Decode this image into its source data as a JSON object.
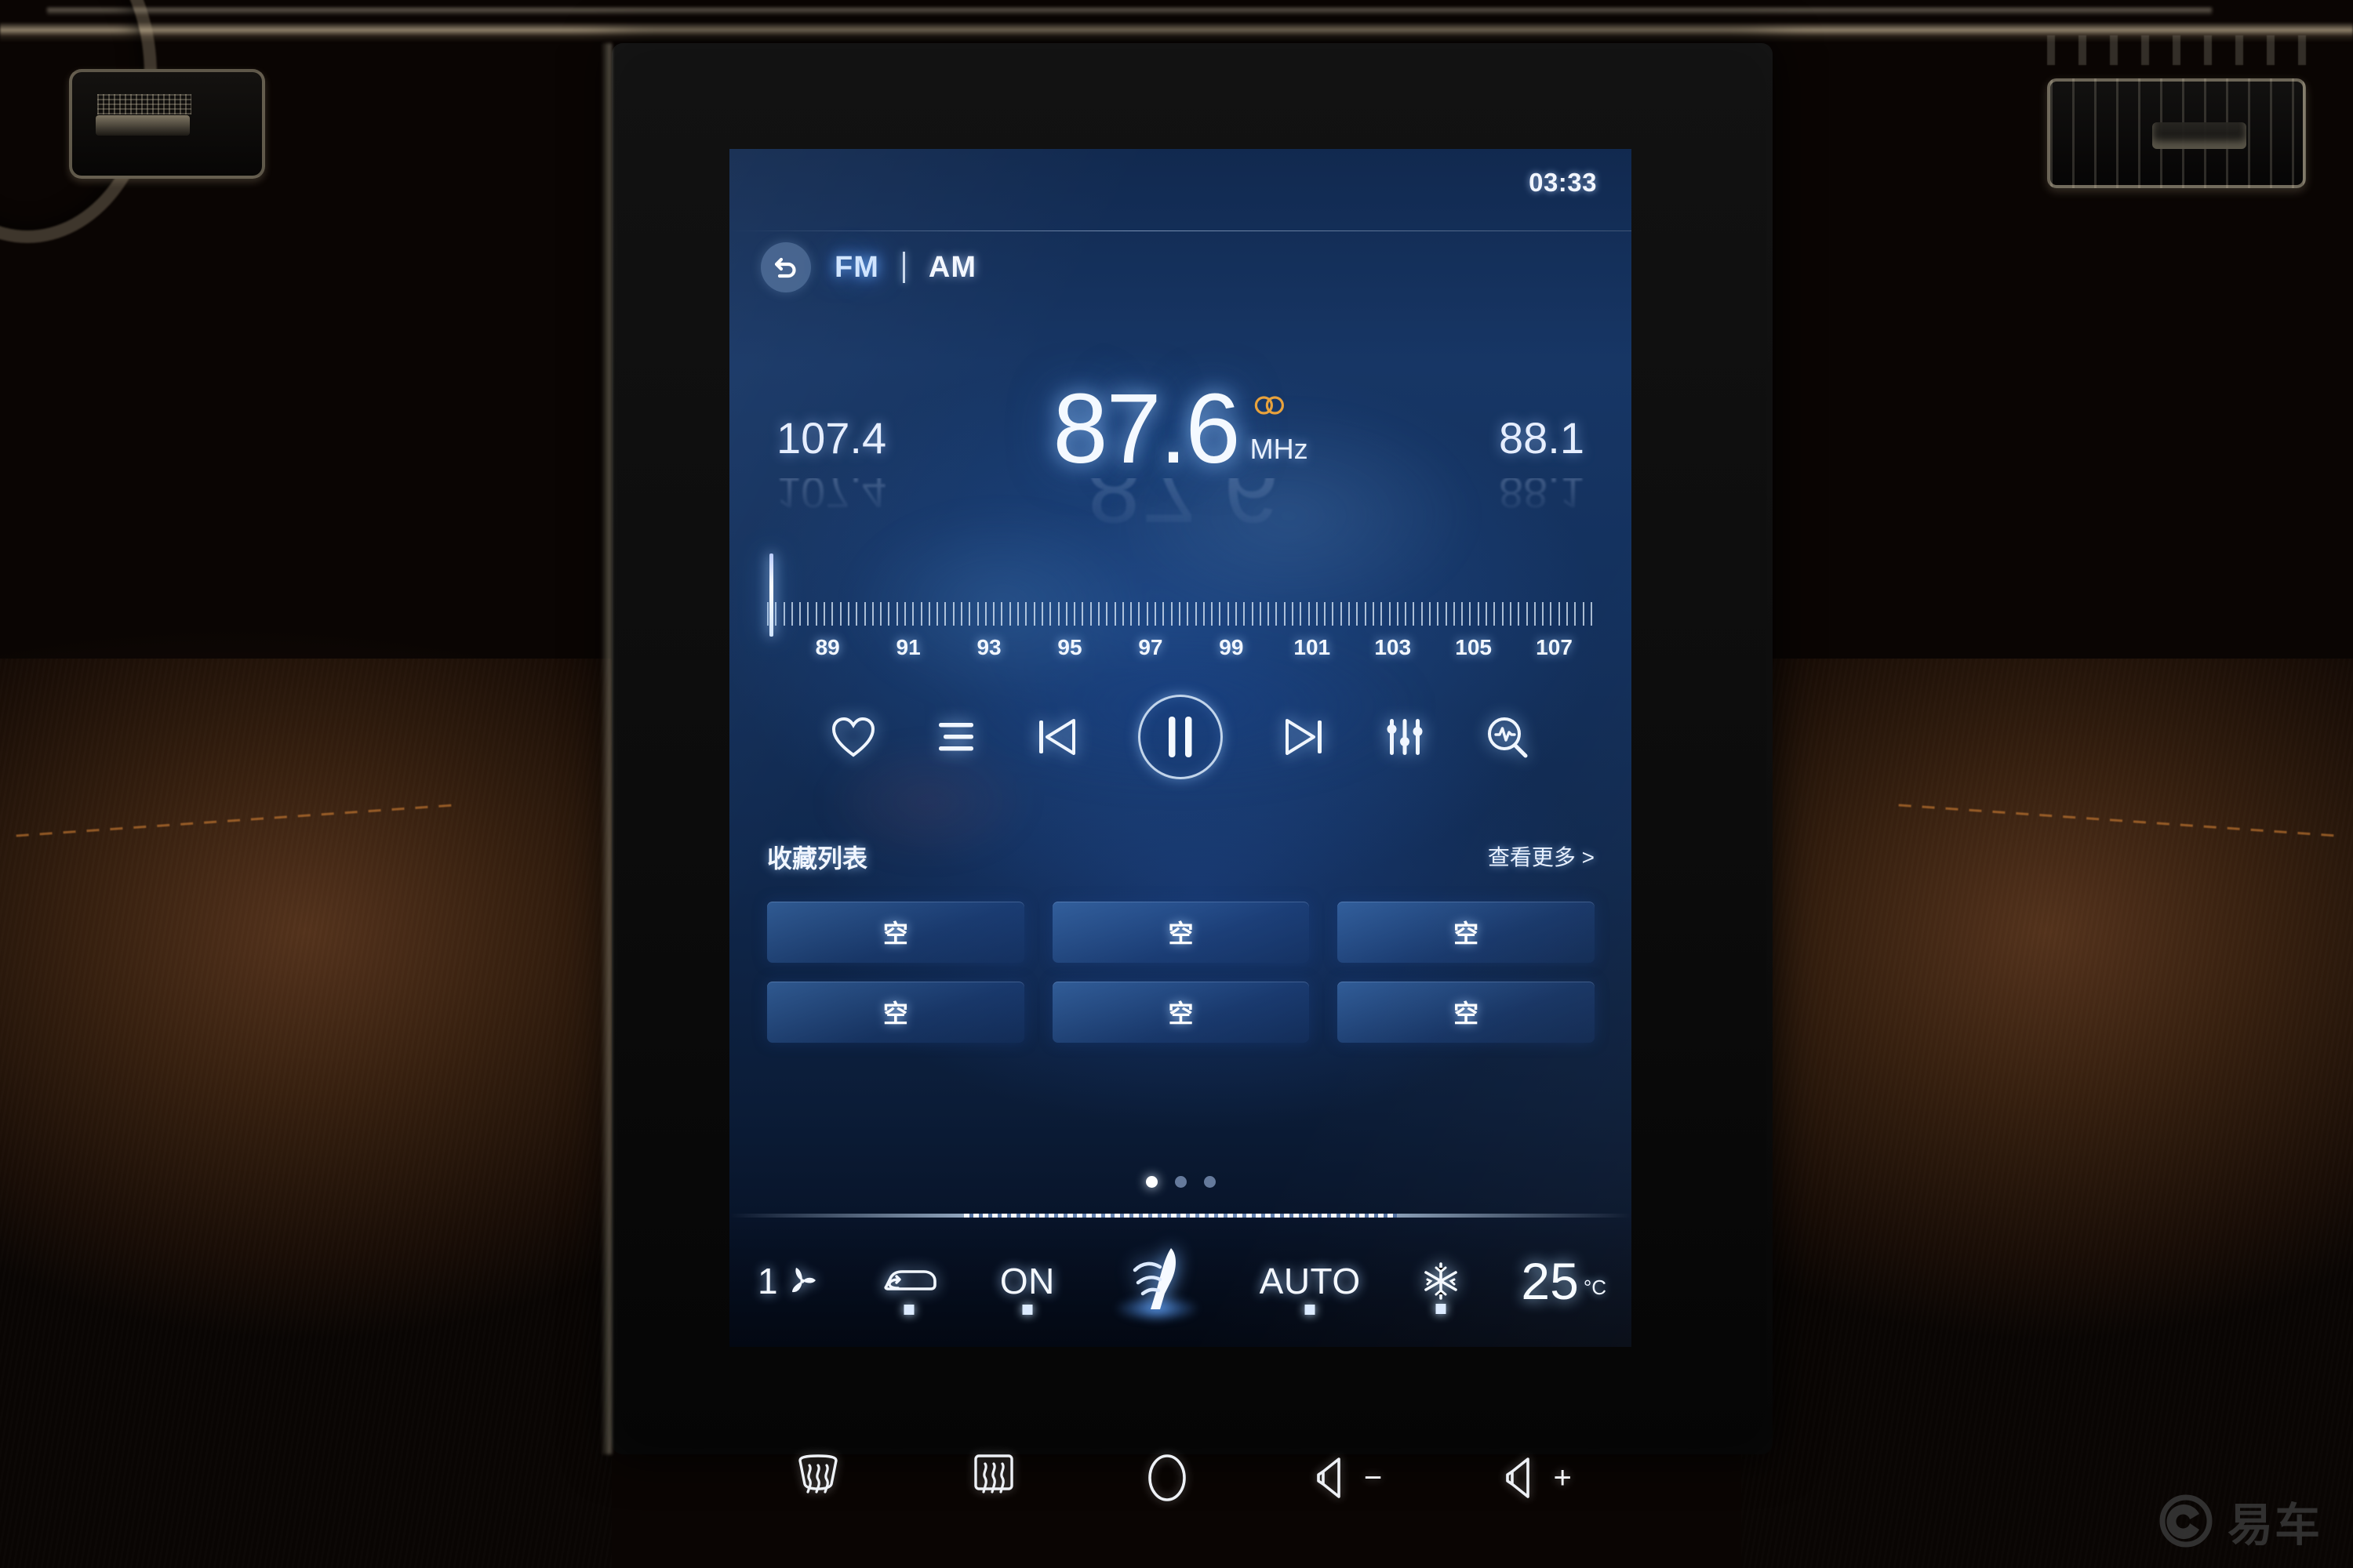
{
  "status_bar": {
    "time": "03:33"
  },
  "header": {
    "back_icon": "back-arrow-icon",
    "bands": [
      {
        "label": "FM",
        "active": true
      },
      {
        "label": "AM",
        "active": false
      }
    ]
  },
  "tuner": {
    "prev_frequency": "107.4",
    "current_frequency": "87.6",
    "unit": "MHz",
    "next_frequency": "88.1",
    "stereo_icon": "stereo-icon",
    "stereo_color": "#e8a23c",
    "cursor_frequency": 87.6
  },
  "chart_data": {
    "type": "line",
    "title": "FM tuning scale",
    "xlabel": "",
    "ylabel": "",
    "xlim": [
      87.5,
      108.0
    ],
    "tick_labels": [
      "89",
      "91",
      "93",
      "95",
      "97",
      "99",
      "101",
      "103",
      "105",
      "107"
    ],
    "tick_values": [
      89,
      91,
      93,
      95,
      97,
      99,
      101,
      103,
      105,
      107
    ],
    "minor_tick_step": 0.2,
    "major_tick_step": 1,
    "cursor": 87.6,
    "grid": false,
    "legend": "none"
  },
  "controls": [
    {
      "name": "favorite-icon",
      "label": "favorite"
    },
    {
      "name": "playlist-icon",
      "label": "list"
    },
    {
      "name": "previous-icon",
      "label": "previous"
    },
    {
      "name": "pause-icon",
      "label": "pause"
    },
    {
      "name": "next-icon",
      "label": "next"
    },
    {
      "name": "equalizer-icon",
      "label": "equalizer"
    },
    {
      "name": "scan-search-icon",
      "label": "scan"
    }
  ],
  "favorites": {
    "title": "收藏列表",
    "more_label": "查看更多 >",
    "presets": [
      "空",
      "空",
      "空",
      "空",
      "空",
      "空"
    ],
    "page_dots": 3,
    "active_dot": 0
  },
  "climate": {
    "fan_speed": "1",
    "fan_icon": "fan-icon",
    "recirculation_icon": "recirculation-icon",
    "ac_state": "ON",
    "seat_airflow_icon": "seat-ventilation-icon",
    "auto_label": "AUTO",
    "snowflake_icon": "snowflake-icon",
    "temperature": "25",
    "temperature_unit": "°C"
  },
  "hardware_buttons": [
    {
      "name": "front-defrost-icon",
      "label": "front defrost"
    },
    {
      "name": "rear-defrost-icon",
      "label": "rear defrost"
    },
    {
      "name": "home-icon",
      "label": "home"
    },
    {
      "name": "volume-down-icon",
      "label": "−"
    },
    {
      "name": "volume-up-icon",
      "label": "+"
    }
  ],
  "watermark": {
    "text": "易车",
    "mark": "yiche-logo-icon"
  },
  "colors": {
    "screen_blue": "#13305c",
    "accent_cyan": "#cfe4ff",
    "stereo_amber": "#e8a23c",
    "preset_tile": "#2f5c9e"
  }
}
